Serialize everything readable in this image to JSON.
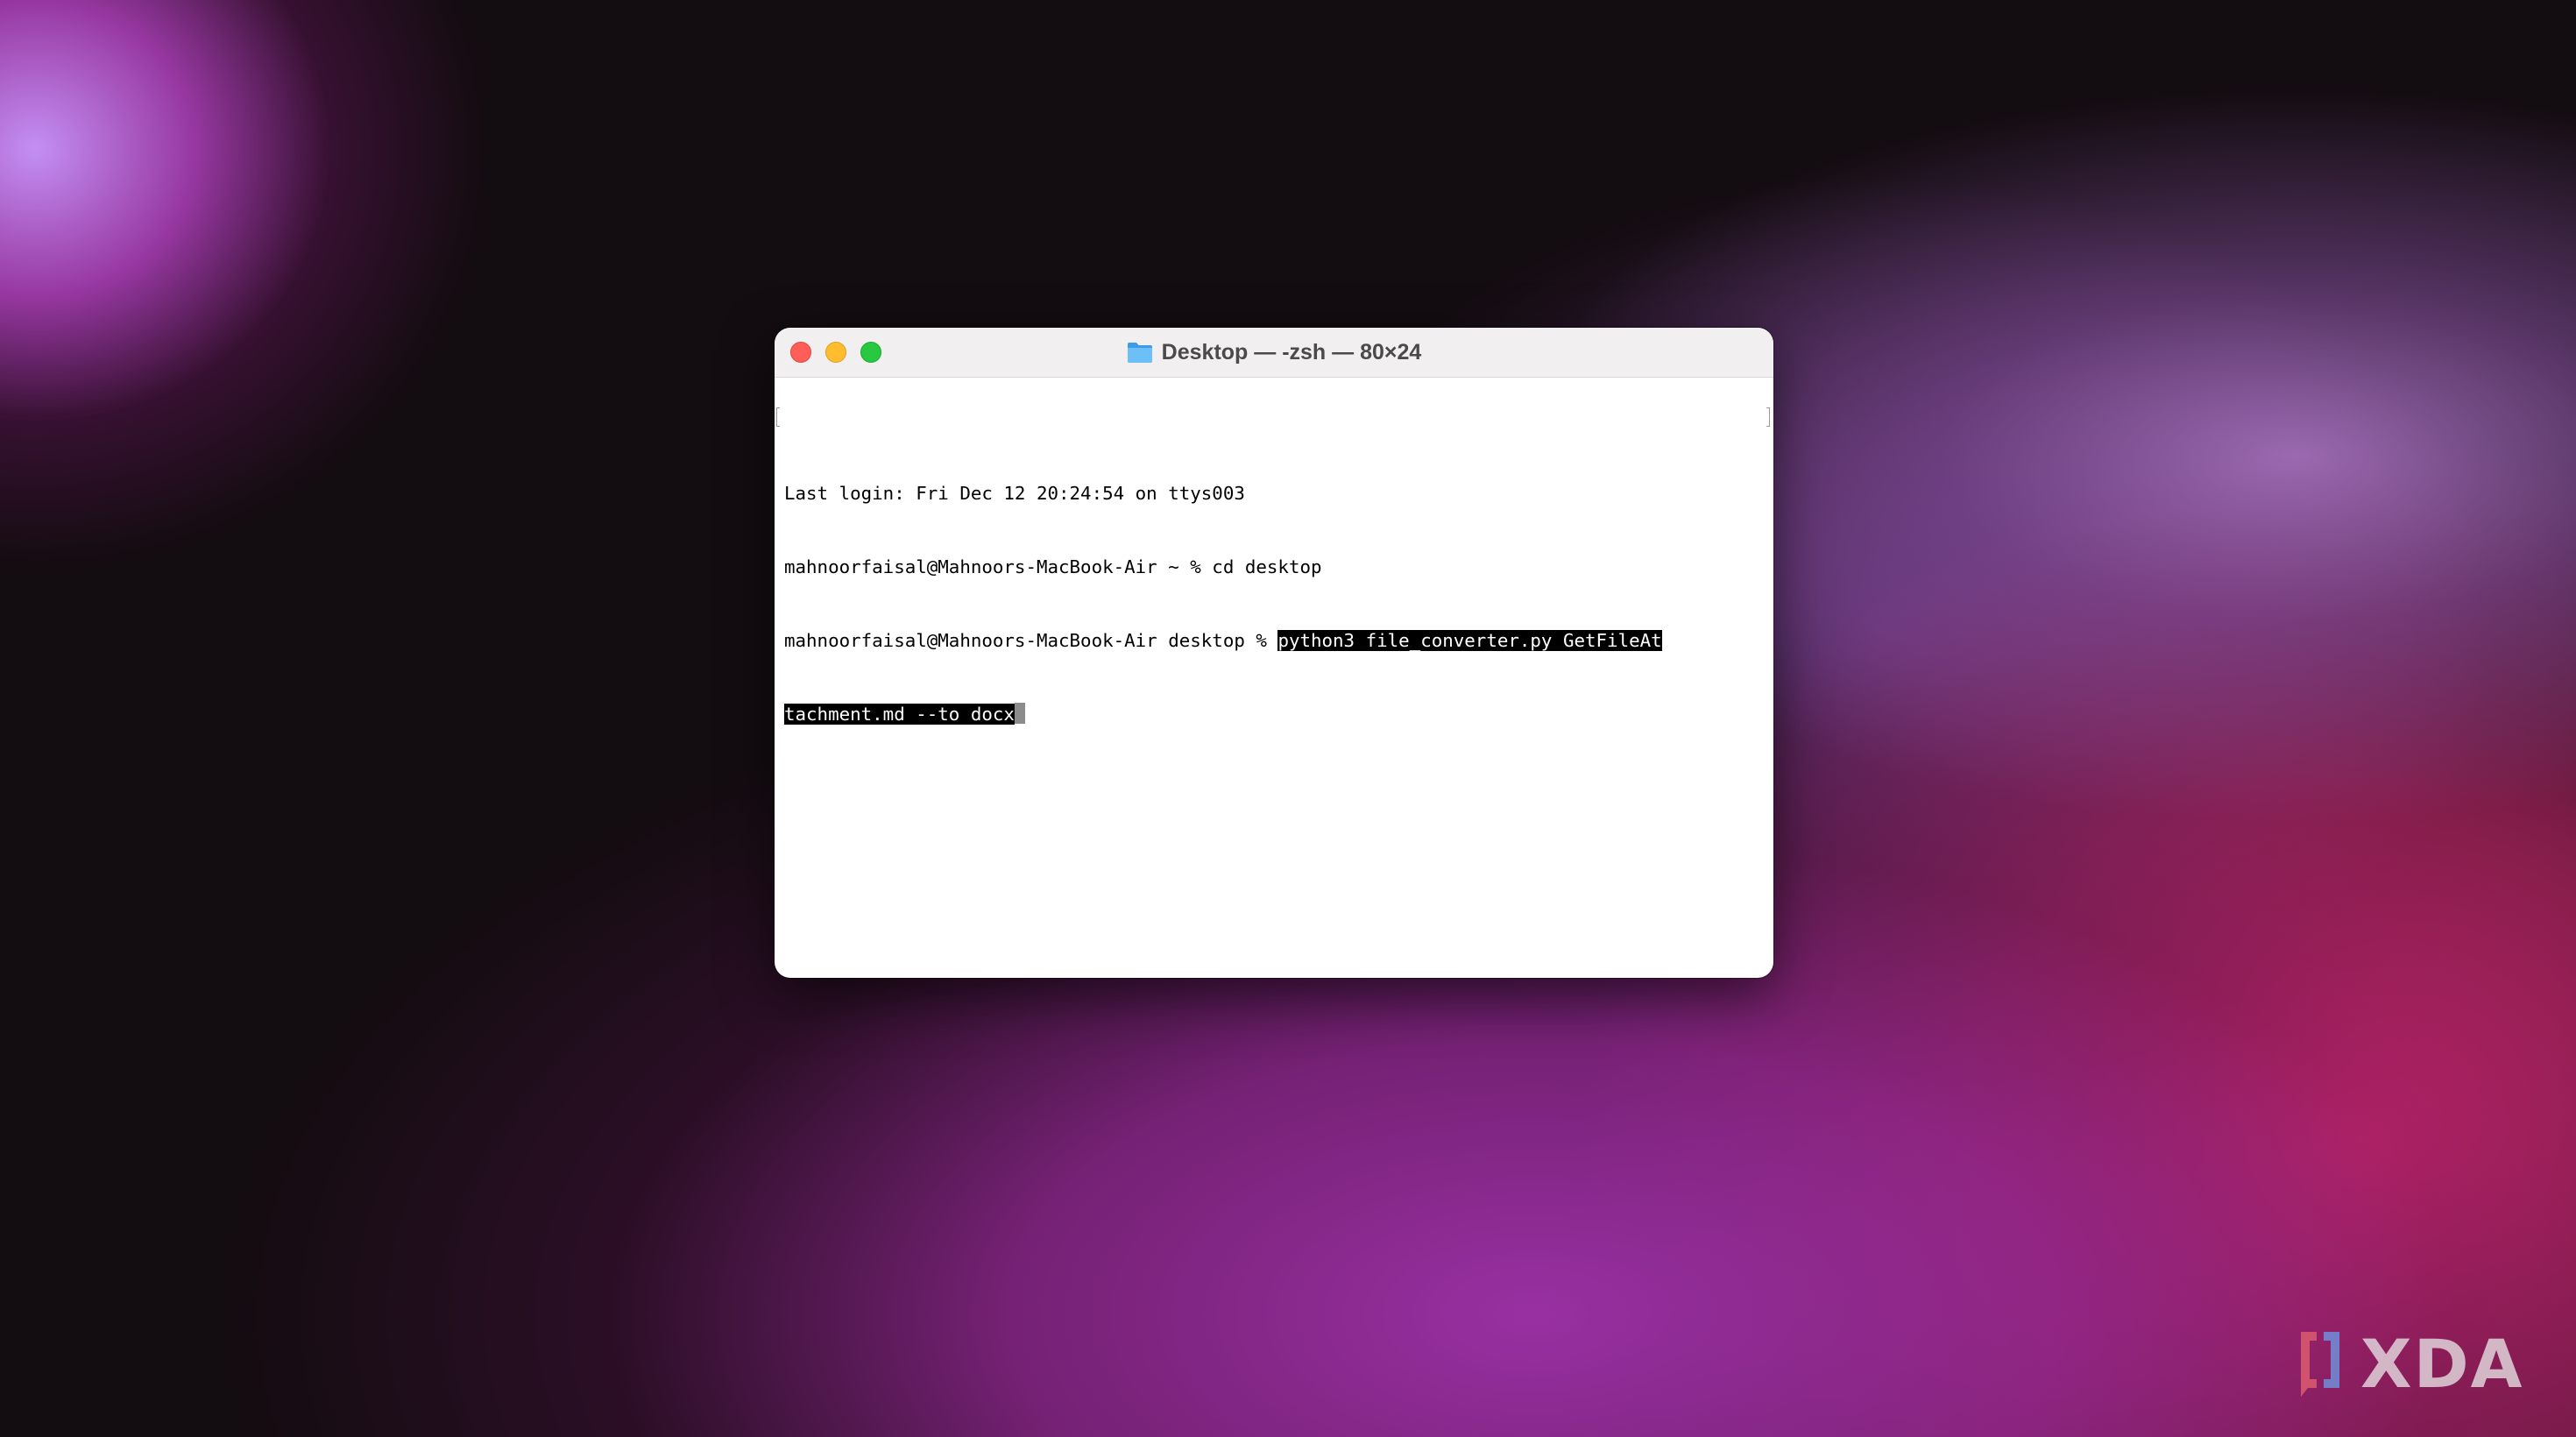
{
  "window": {
    "title": "Desktop — -zsh — 80×24"
  },
  "terminal": {
    "line1": "Last login: Fri Dec 12 20:24:54 on ttys003",
    "line2": "mahnoorfaisal@Mahnoors-MacBook-Air ~ % cd desktop",
    "line3_prompt": "mahnoorfaisal@Mahnoors-MacBook-Air desktop % ",
    "line3_command": "python3 file_converter.py GetFileAt",
    "line4_command": "tachment.md --to docx"
  },
  "watermark": {
    "text": "XDA"
  },
  "colors": {
    "close": "#ff5f57",
    "minimize": "#febc2e",
    "zoom": "#28c840",
    "selection": "#000000",
    "titlebar": "#f2eff1"
  },
  "icons": {
    "title": "folder-icon",
    "logo": "xda-logo-icon"
  }
}
